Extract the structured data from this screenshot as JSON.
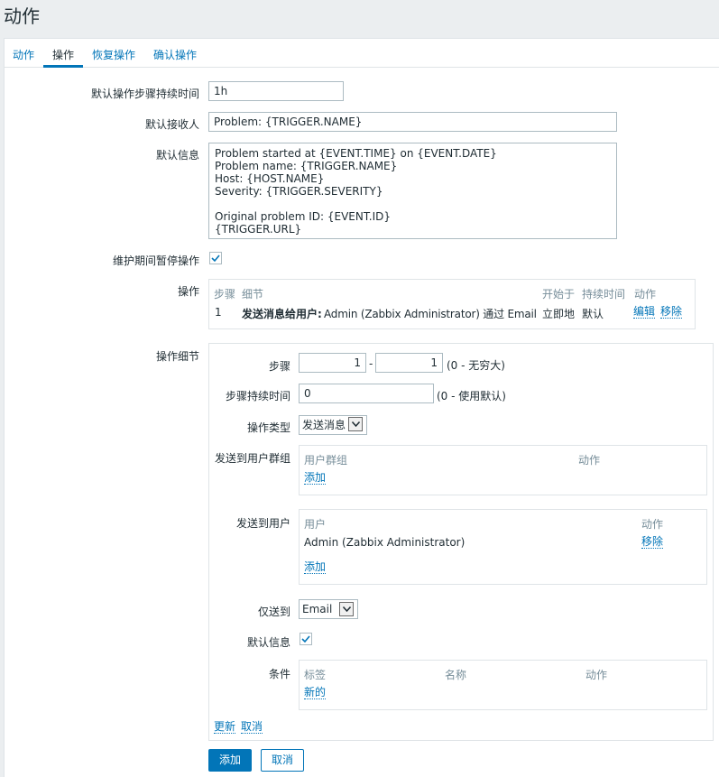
{
  "page": {
    "title": "动作"
  },
  "tabs": [
    {
      "label": "动作"
    },
    {
      "label": "操作"
    },
    {
      "label": "恢复操作"
    },
    {
      "label": "确认操作"
    }
  ],
  "form": {
    "default_step_duration": {
      "label": "默认操作步骤持续时间",
      "value": "1h"
    },
    "default_subject": {
      "label": "默认接收人",
      "value": "Problem: {TRIGGER.NAME}"
    },
    "default_message": {
      "label": "默认信息",
      "value": "Problem started at {EVENT.TIME} on {EVENT.DATE}\nProblem name: {TRIGGER.NAME}\nHost: {HOST.NAME}\nSeverity: {TRIGGER.SEVERITY}\n\nOriginal problem ID: {EVENT.ID}\n{TRIGGER.URL}"
    },
    "pause_in_maintenance": {
      "label": "维护期间暂停操作",
      "checked": true
    },
    "operations": {
      "label": "操作",
      "headers": {
        "steps": "步骤",
        "details": "细节",
        "start_in": "开始于",
        "duration": "持续时间",
        "action": "动作"
      },
      "rows": [
        {
          "steps": "1",
          "details_bold": "发送消息给用户:",
          "details_rest": "Admin (Zabbix Administrator) 通过 Email",
          "start_in": "立即地",
          "duration": "默认",
          "edit": "编辑",
          "remove": "移除"
        }
      ]
    },
    "operation_details": {
      "label": "操作细节",
      "steps": {
        "label": "步骤",
        "from": "1",
        "separator": "-",
        "to": "1",
        "hint": "(0 - 无穷大)"
      },
      "step_duration": {
        "label": "步骤持续时间",
        "value": "0",
        "hint": "(0 - 使用默认)"
      },
      "operation_type": {
        "label": "操作类型",
        "value": "发送消息"
      },
      "send_to_groups": {
        "label": "发送到用户群组",
        "headers": {
          "group": "用户群组",
          "action": "动作"
        },
        "add": "添加"
      },
      "send_to_users": {
        "label": "发送到用户",
        "headers": {
          "user": "用户",
          "action": "动作"
        },
        "rows": [
          {
            "user": "Admin (Zabbix Administrator)",
            "remove": "移除"
          }
        ],
        "add": "添加"
      },
      "send_only_to": {
        "label": "仅送到",
        "value": "Email"
      },
      "default_message": {
        "label": "默认信息",
        "checked": true
      },
      "conditions": {
        "label": "条件",
        "headers": {
          "label": "标签",
          "name": "名称",
          "action": "动作"
        },
        "new": "新的"
      },
      "update": "更新",
      "cancel": "取消"
    }
  },
  "buttons": {
    "add": "添加",
    "cancel": "取消"
  },
  "colors": {
    "accent": "#0275b8",
    "background": "#ebeef0",
    "border": "#dfe4e7"
  }
}
